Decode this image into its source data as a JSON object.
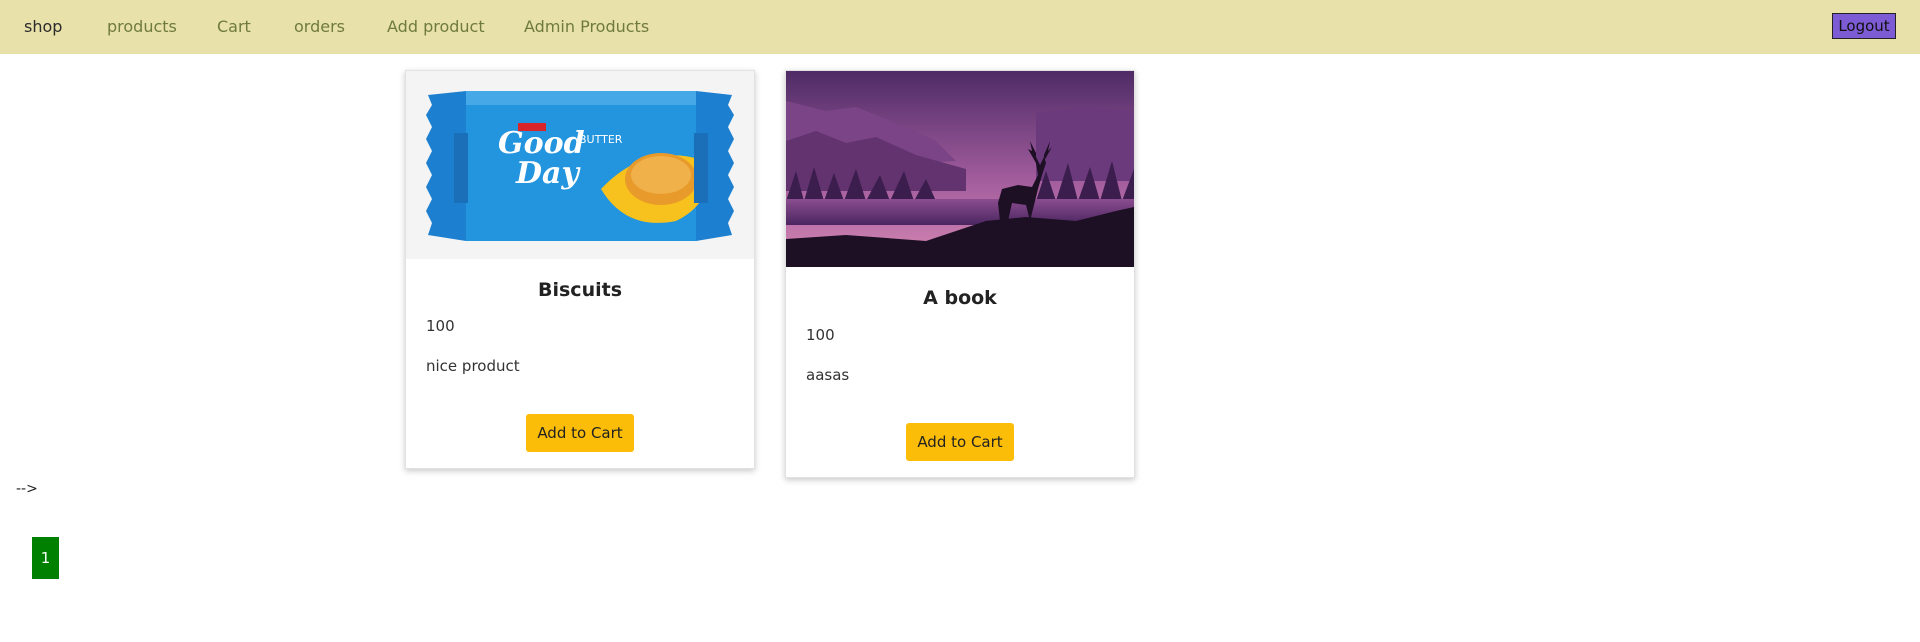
{
  "nav": {
    "items": [
      {
        "label": "shop",
        "active": true
      },
      {
        "label": "products"
      },
      {
        "label": "Cart"
      },
      {
        "label": "orders"
      },
      {
        "label": "Add product"
      },
      {
        "label": "Admin Products"
      }
    ],
    "logout_label": "Logout",
    "bar_color": "#e8e1a9",
    "logout_color": "#7d5bd4"
  },
  "products": [
    {
      "title": "Biscuits",
      "price": "100",
      "description": "nice product",
      "image_icon": "biscuit-package-image",
      "button_label": "Add to Cart"
    },
    {
      "title": "A book",
      "price": "100",
      "description": "aasas",
      "image_icon": "deer-landscape-image",
      "button_label": "Add to Cart"
    }
  ],
  "stray_text": "-->",
  "pagination": {
    "pages": [
      "1"
    ],
    "active_color": "#008000"
  },
  "accent": {
    "add_to_cart": "#fbbd08"
  }
}
